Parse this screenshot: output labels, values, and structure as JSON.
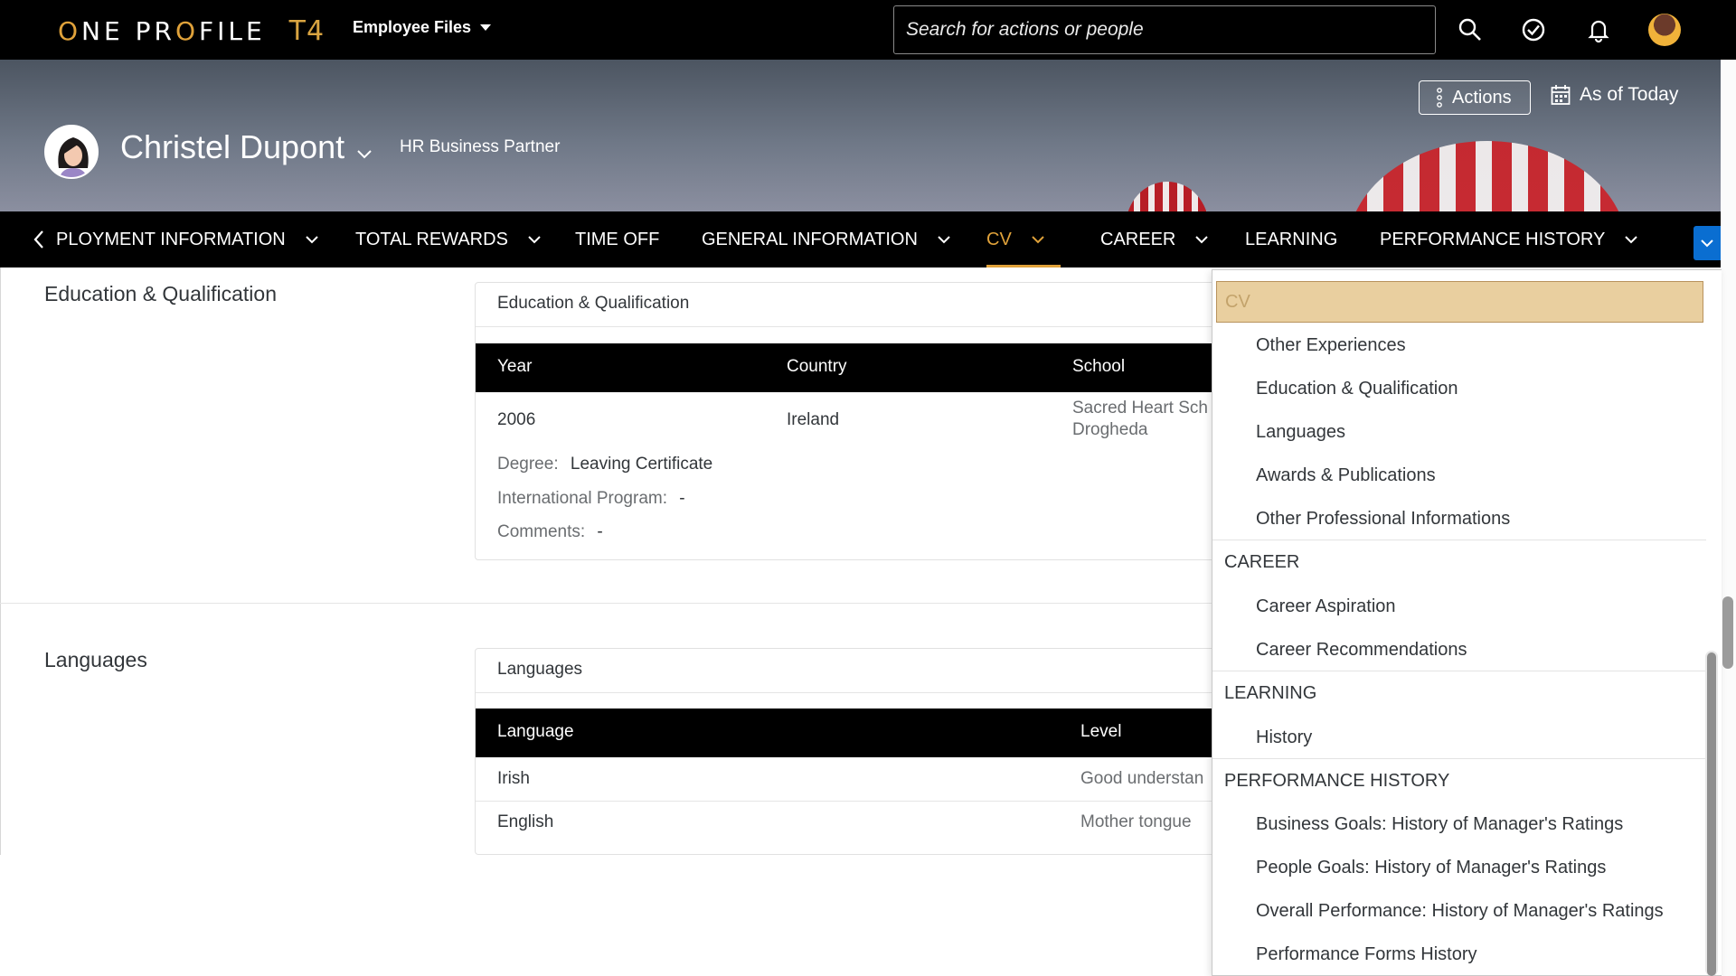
{
  "shell": {
    "logo_text": "ONE PROFILE",
    "logo_suffix": "T4",
    "menu_label": "Employee Files",
    "search_placeholder": "Search for actions or people",
    "icons": [
      "search-icon",
      "check-circle-icon",
      "bell-icon",
      "user-avatar"
    ]
  },
  "header": {
    "name": "Christel Dupont",
    "title": "HR Business Partner",
    "actions_label": "Actions",
    "asof_label": "As of Today"
  },
  "sections_nav": {
    "tabs": [
      {
        "label": "PLOYMENT INFORMATION",
        "has_menu": true
      },
      {
        "label": "TOTAL REWARDS",
        "has_menu": true
      },
      {
        "label": "TIME OFF",
        "has_menu": false
      },
      {
        "label": "GENERAL INFORMATION",
        "has_menu": true
      },
      {
        "label": "CV",
        "has_menu": true,
        "active": true
      },
      {
        "label": "CAREER",
        "has_menu": true
      },
      {
        "label": "LEARNING",
        "has_menu": false
      },
      {
        "label": "PERFORMANCE HISTORY",
        "has_menu": true
      }
    ]
  },
  "education": {
    "section_title": "Education & Qualification",
    "card_title": "Education & Qualification",
    "columns": [
      "Year",
      "Country",
      "School"
    ],
    "row": {
      "year": "2006",
      "country": "Ireland",
      "school_line1": "Sacred Heart Sch",
      "school_line2": "Drogheda",
      "degree_label": "Degree:",
      "degree_value": "Leaving Certificate",
      "intl_label": "International Program:",
      "intl_value": "-",
      "comments_label": "Comments:",
      "comments_value": "-"
    }
  },
  "languages": {
    "section_title": "Languages",
    "card_title": "Languages",
    "columns": [
      "Language",
      "Level"
    ],
    "rows": [
      {
        "language": "Irish",
        "level": "Good understan"
      },
      {
        "language": "English",
        "level": "Mother tongue"
      }
    ]
  },
  "dropdown": {
    "items": [
      {
        "label": "CV",
        "type": "group",
        "selected": true
      },
      {
        "label": "Other Experiences",
        "type": "child"
      },
      {
        "label": "Education & Qualification",
        "type": "child"
      },
      {
        "label": "Languages",
        "type": "child"
      },
      {
        "label": "Awards & Publications",
        "type": "child"
      },
      {
        "label": "Other Professional Informations",
        "type": "child"
      },
      {
        "label": "CAREER",
        "type": "group"
      },
      {
        "label": "Career Aspiration",
        "type": "child"
      },
      {
        "label": "Career Recommendations",
        "type": "child"
      },
      {
        "label": "LEARNING",
        "type": "group"
      },
      {
        "label": "History",
        "type": "child"
      },
      {
        "label": "PERFORMANCE HISTORY",
        "type": "group"
      },
      {
        "label": "Business Goals: History of Manager's Ratings",
        "type": "child"
      },
      {
        "label": "People Goals: History of Manager's Ratings",
        "type": "child"
      },
      {
        "label": "Overall Performance: History of Manager's Ratings",
        "type": "child"
      },
      {
        "label": "Performance Forms History",
        "type": "child"
      }
    ]
  },
  "colors": {
    "accent_gold": "#e0a23a",
    "selected_bg": "#e9cf9f",
    "nav_bg": "#000000",
    "more_button": "#0a6ed1"
  }
}
